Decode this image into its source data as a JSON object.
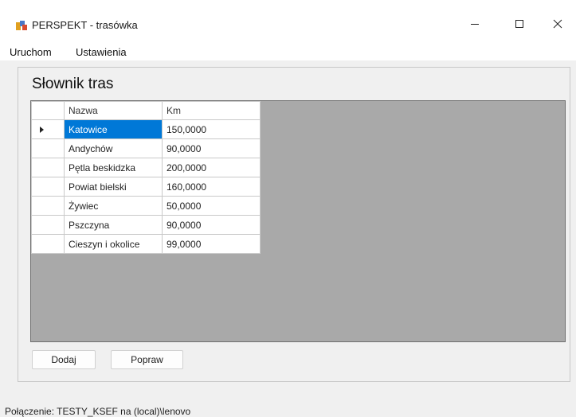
{
  "window": {
    "title": "PERSPEKT - trasówka",
    "controls": {
      "minimize": "minimize-icon",
      "maximize": "maximize-icon",
      "close": "close-icon"
    }
  },
  "menu": {
    "items": [
      "Uruchom",
      "Ustawienia"
    ]
  },
  "page": {
    "title": "Słownik tras"
  },
  "grid": {
    "columns": [
      "Nazwa",
      "Km"
    ],
    "rows": [
      {
        "nazwa": "Katowice",
        "km": "150,0000",
        "selected": true
      },
      {
        "nazwa": "Andychów",
        "km": "90,0000"
      },
      {
        "nazwa": "Pętla beskidzka",
        "km": "200,0000"
      },
      {
        "nazwa": "Powiat bielski",
        "km": "160,0000"
      },
      {
        "nazwa": "Żywiec",
        "km": "50,0000"
      },
      {
        "nazwa": "Pszczyna",
        "km": "90,0000"
      },
      {
        "nazwa": "Cieszyn i okolice",
        "km": "99,0000"
      }
    ]
  },
  "buttons": {
    "add": "Dodaj",
    "edit": "Popraw"
  },
  "status": {
    "connection": "Połączenie: TESTY_KSEF na (local)\\lenovo"
  },
  "colors": {
    "selection": "#0078d7",
    "grid_background": "#a9a9a9"
  }
}
